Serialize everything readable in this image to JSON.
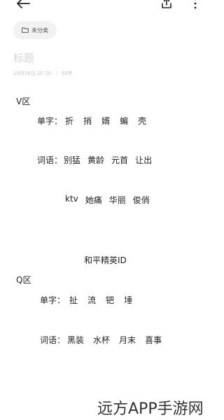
{
  "header": {
    "back_icon": "arrow-left-icon",
    "share_icon": "share-icon",
    "more_icon": "more-vertical-icon"
  },
  "category": {
    "icon": "folder-icon",
    "label": "未分类"
  },
  "note": {
    "title_placeholder": "标题",
    "date": "10月26日 20:20",
    "separator": "|",
    "word_count": "50字"
  },
  "content": {
    "section_v": "V区",
    "v_chars_label": "单字：",
    "v_chars": [
      "折",
      "捎",
      "婿",
      "蝙",
      "壳"
    ],
    "v_words_label": "词语：",
    "v_words": [
      "别猛",
      "黄龄",
      "元首",
      "让出"
    ],
    "v_words2": [
      "ktv",
      "她痛",
      "华丽",
      "俊俏"
    ],
    "center_heading": "和平精英ID",
    "section_q": "Q区",
    "q_chars_label": "单字：",
    "q_chars": [
      "扯",
      "流",
      "钯",
      "埵"
    ],
    "q_words_label": "词语：",
    "q_words": [
      "黑装",
      "水杯",
      "月末",
      "喜事"
    ]
  },
  "watermark": "远方APP手游网"
}
